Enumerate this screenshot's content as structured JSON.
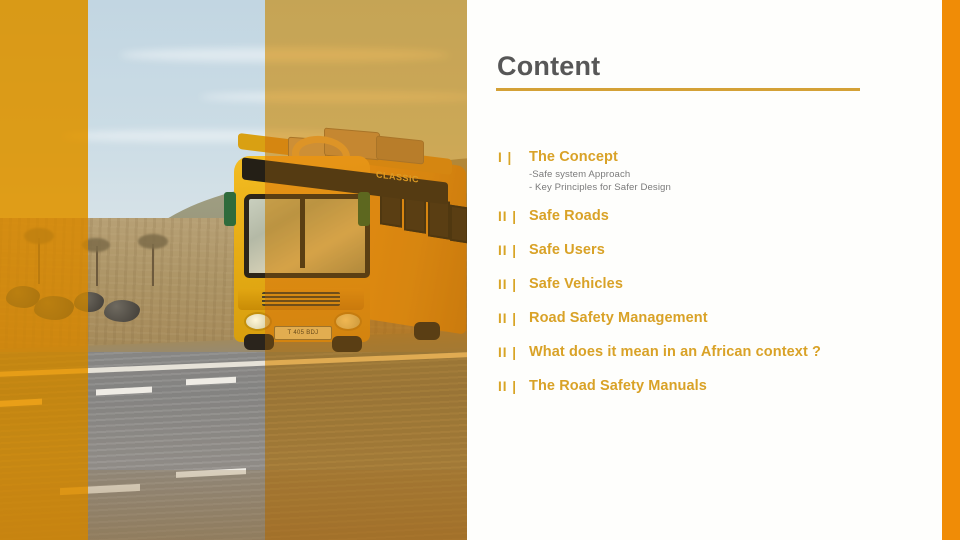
{
  "slide": {
    "title": "Content",
    "background_color": "#fefefc",
    "accent_color": "#d4a136",
    "right_bar_color": "#f08c06",
    "item_color": "#d9a227",
    "title_color": "#575757",
    "sub_color": "#7b7b7b"
  },
  "photo": {
    "alt_name": "yellow-bus-on-african-road",
    "bus_banner_text": "CLASSIC",
    "bus_plate_text": "T 405  BDJ",
    "overlay_color": "#eda313"
  },
  "toc": {
    "items": [
      {
        "marker": "I |",
        "label": "The Concept",
        "sub": [
          "-Safe system Approach",
          "- Key Principles for Safer Design"
        ]
      },
      {
        "marker": "II |",
        "label": "Safe Roads",
        "sub": []
      },
      {
        "marker": "II |",
        "label": "Safe Users",
        "sub": []
      },
      {
        "marker": "II |",
        "label": "Safe Vehicles",
        "sub": []
      },
      {
        "marker": "II |",
        "label": "Road Safety Management",
        "sub": []
      },
      {
        "marker": "II |",
        "label": "What does it mean in an African context ?",
        "sub": []
      },
      {
        "marker": "II |",
        "label": "The Road Safety Manuals",
        "sub": []
      }
    ]
  }
}
